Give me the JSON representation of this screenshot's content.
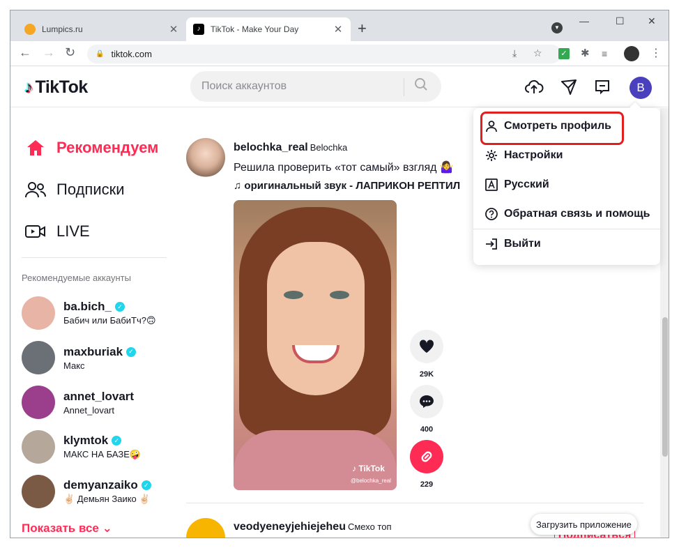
{
  "browser": {
    "tabs": [
      {
        "title": "Lumpics.ru",
        "active": false,
        "favicon_color": "#f5a623"
      },
      {
        "title": "TikTok - Make Your Day",
        "active": true,
        "favicon_color": "#000000"
      }
    ],
    "new_tab_label": "+",
    "url": "tiktok.com"
  },
  "tiktok": {
    "logo_text": "TikTok",
    "search_placeholder": "Поиск аккаунтов",
    "avatar_letter": "B",
    "nav": [
      {
        "label": "Рекомендуем",
        "icon": "home-icon",
        "active": true
      },
      {
        "label": "Подписки",
        "icon": "following-icon",
        "active": false
      },
      {
        "label": "LIVE",
        "icon": "live-icon",
        "active": false
      }
    ],
    "suggested_title": "Рекомендуемые аккаунты",
    "accounts": [
      {
        "username": "ba.bich_",
        "display_name": "Бабич или БабиТч?🙃",
        "color": "#e8b4a6"
      },
      {
        "username": "maxburiak",
        "display_name": "Макс",
        "color": "#6b6f76"
      },
      {
        "username": "annet_lovart",
        "display_name": "Annet_lovart",
        "color": "#9b3f8c"
      },
      {
        "username": "klymtok",
        "display_name": "МАКС НА БАЗЕ🤪",
        "color": "#b5a79a"
      },
      {
        "username": "demyanzaiko",
        "display_name": "✌🏻 Демьян Заико ✌🏻",
        "color": "#7a5a45"
      }
    ],
    "show_all": "Показать все",
    "post": {
      "username": "belochka_real",
      "nickname": "Belochka",
      "description": "Решила проверить «тот самый» взгляд 🤷‍♀️",
      "sound": "♫ оригинальный звук - ЛАПРИКОН РЕПТИЛ",
      "watermark": "TikTok",
      "watermark_user": "@belochka_real",
      "likes": "29K",
      "comments": "400",
      "shares": "229"
    },
    "post2": {
      "username": "veodyeneyjehiejeheu",
      "nickname": "Смехо топ",
      "follow_label": "Подписаться"
    },
    "get_app": "Загрузить приложение",
    "menu": {
      "items": [
        {
          "label": "Смотреть профиль",
          "icon": "user-icon"
        },
        {
          "label": "Настройки",
          "icon": "settings-icon"
        },
        {
          "label": "Русский",
          "icon": "language-icon"
        },
        {
          "label": "Обратная связь и помощь",
          "icon": "help-icon"
        },
        {
          "label": "Выйти",
          "icon": "logout-icon"
        }
      ],
      "highlight_color": "#e0201f"
    },
    "accent": "#fe2c55",
    "verified_color": "#20d5ec"
  }
}
